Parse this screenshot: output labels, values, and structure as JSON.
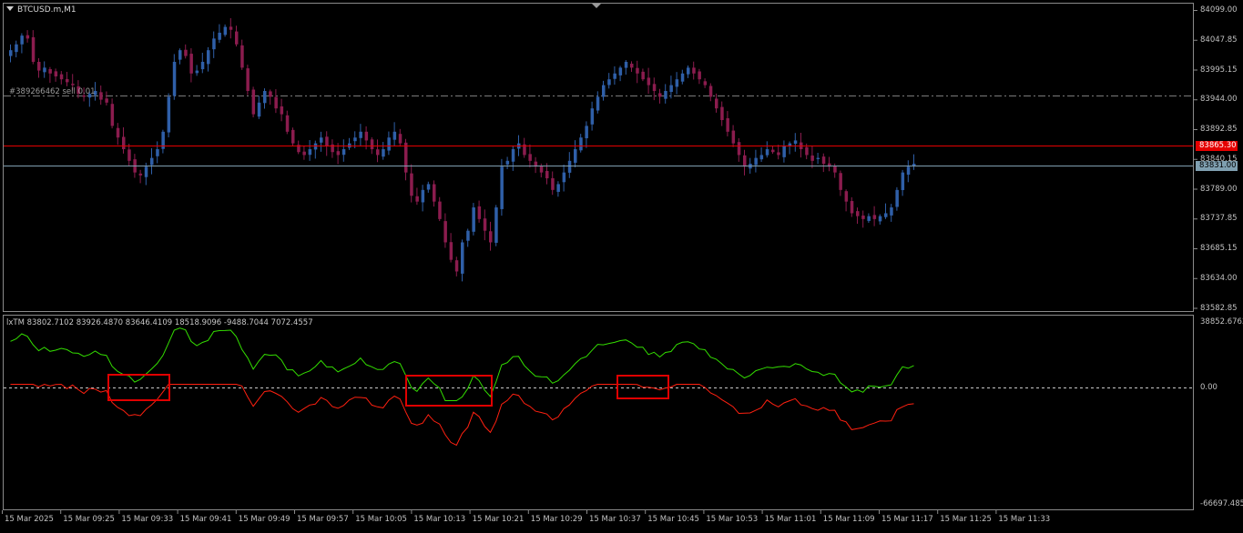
{
  "window": {
    "title": "BTCUSD.m,M1"
  },
  "order_line": {
    "label": "#389266462 sell 0.01"
  },
  "price_axis": {
    "ticks": [
      "84099.00",
      "84047.85",
      "83995.15",
      "83944.00",
      "83892.85",
      "83840.15",
      "83789.00",
      "83737.85",
      "83685.15",
      "83634.00",
      "83582.85"
    ],
    "ask_line": {
      "value": "83865.30",
      "color": "#e50000"
    },
    "bid_line": {
      "value": "83831.00",
      "color": "#7f9fb0"
    }
  },
  "indicator": {
    "label": "lxTM 83802.7102 83926.4870 83646.4109 18518.9096 -9488.7044 7072.4557",
    "axis_ticks": [
      "38852.6762",
      "0.00",
      "-66697.4851"
    ],
    "up_color": "#33dd00",
    "down_color": "#ff2010"
  },
  "time_axis": {
    "ticks": [
      "15 Mar 2025",
      "15 Mar 09:25",
      "15 Mar 09:33",
      "15 Mar 09:41",
      "15 Mar 09:49",
      "15 Mar 09:57",
      "15 Mar 10:05",
      "15 Mar 10:13",
      "15 Mar 10:21",
      "15 Mar 10:29",
      "15 Mar 10:37",
      "15 Mar 10:45",
      "15 Mar 10:53",
      "15 Mar 11:01",
      "15 Mar 11:09",
      "15 Mar 11:17",
      "15 Mar 11:25",
      "15 Mar 11:33"
    ]
  },
  "colors": {
    "bull": "#2f5fa8",
    "bear": "#8b1c4e",
    "background": "#000000",
    "frame": "#8a8a8a"
  },
  "chart_data": {
    "type": "candlestick",
    "timeframe": "M1",
    "closes": [
      84030,
      84040,
      84055,
      84050,
      84010,
      83995,
      84000,
      83990,
      83985,
      83980,
      83975,
      83970,
      83955,
      83950,
      83955,
      83960,
      83945,
      83940,
      83900,
      83880,
      83860,
      83840,
      83820,
      83815,
      83830,
      83845,
      83860,
      83890,
      83950,
      84010,
      84030,
      84020,
      83990,
      83995,
      84010,
      84030,
      84050,
      84060,
      84070,
      84065,
      84040,
      84000,
      83960,
      83920,
      83940,
      83960,
      83950,
      83930,
      83920,
      83890,
      83870,
      83855,
      83850,
      83860,
      83870,
      83880,
      83865,
      83855,
      83850,
      83860,
      83870,
      83880,
      83890,
      83875,
      83860,
      83850,
      83860,
      83880,
      83890,
      83870,
      83820,
      83780,
      83770,
      83790,
      83800,
      83770,
      83740,
      83700,
      83670,
      83650,
      83700,
      83720,
      83760,
      83740,
      83720,
      83700,
      83760,
      83830,
      83840,
      83860,
      83870,
      83850,
      83840,
      83830,
      83820,
      83810,
      83790,
      83800,
      83820,
      83840,
      83860,
      83880,
      83900,
      83930,
      83950,
      83970,
      83980,
      83990,
      84000,
      84010,
      84000,
      83990,
      83980,
      83970,
      83960,
      83950,
      83960,
      83970,
      83980,
      83990,
      84000,
      83990,
      83980,
      83970,
      83950,
      83930,
      83910,
      83890,
      83870,
      83850,
      83830,
      83835,
      83845,
      83850,
      83860,
      83855,
      83850,
      83865,
      83870,
      83875,
      83860,
      83850,
      83840,
      83845,
      83835,
      83830,
      83820,
      83790,
      83770,
      83750,
      83745,
      83740,
      83745,
      83740,
      83745,
      83750,
      83760,
      83790,
      83820,
      83830,
      83835
    ],
    "approx_range": [
      83582.85,
      84099.0
    ],
    "indicator_series": [
      {
        "name": "up",
        "color": "#33dd00"
      },
      {
        "name": "down",
        "color": "#ff2010"
      }
    ]
  }
}
